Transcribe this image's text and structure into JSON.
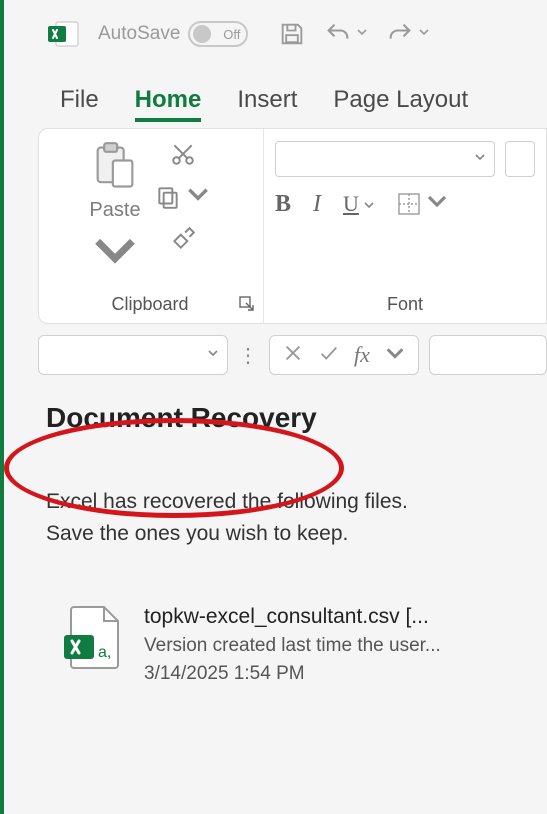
{
  "qat": {
    "autosave_label": "AutoSave",
    "autosave_state": "Off"
  },
  "tabs": {
    "file": "File",
    "home": "Home",
    "insert": "Insert",
    "page_layout": "Page Layout"
  },
  "ribbon": {
    "clipboard": {
      "paste_label": "Paste",
      "group_label": "Clipboard"
    },
    "font": {
      "group_label": "Font"
    }
  },
  "recovery": {
    "title": "Document Recovery",
    "description_line1": "Excel has recovered the following files.",
    "description_line2": "Save the ones you wish to keep.",
    "file": {
      "name": "topkw-excel_consultant.csv  [...",
      "version": "Version created last time the user...",
      "date": "3/14/2025 1:54 PM"
    }
  }
}
